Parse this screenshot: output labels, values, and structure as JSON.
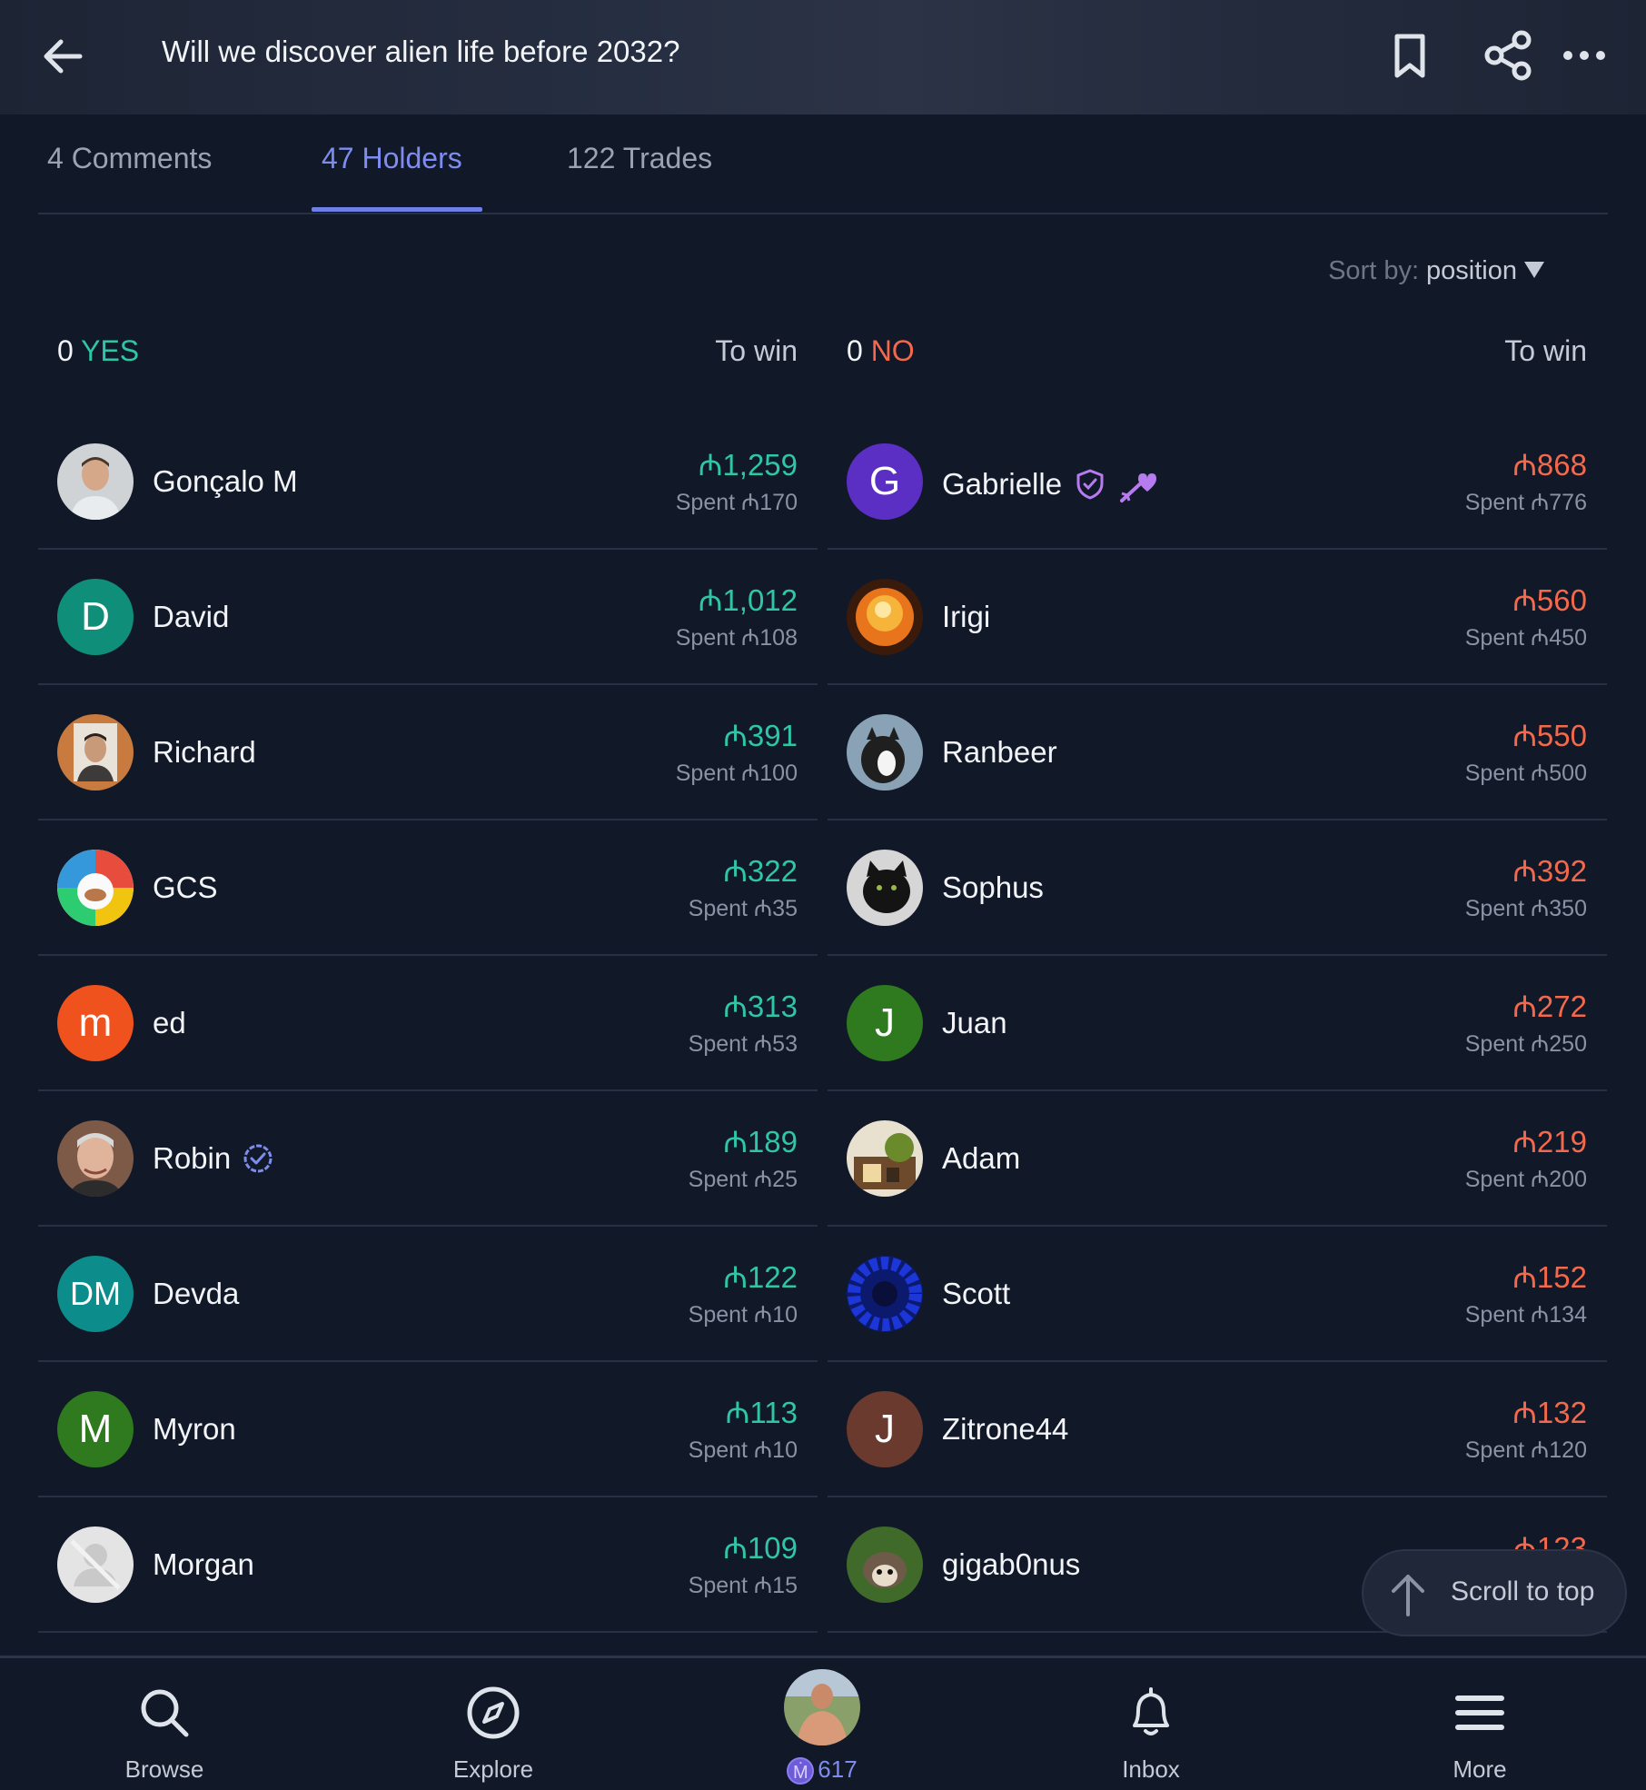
{
  "header": {
    "title": "Will we discover alien life before 2032?",
    "back_icon": "arrow-left-icon",
    "bookmark_icon": "bookmark-icon",
    "share_icon": "share-icon",
    "more_icon": "more-horizontal-icon"
  },
  "tabs": [
    {
      "label": "4 Comments",
      "active": false
    },
    {
      "label": "47 Holders",
      "active": true
    },
    {
      "label": "122 Trades",
      "active": false
    }
  ],
  "sort": {
    "label": "Sort by:",
    "value": "position"
  },
  "yes_column": {
    "count": "0",
    "side": "YES",
    "towin_label": "To win",
    "rows": [
      {
        "name": "Gonçalo M",
        "to_win": "₼1,259",
        "spent": "Spent ₼170"
      },
      {
        "name": "David",
        "to_win": "₼1,012",
        "spent": "Spent ₼108",
        "initials": "D"
      },
      {
        "name": "Richard",
        "to_win": "₼391",
        "spent": "Spent ₼100"
      },
      {
        "name": "GCS",
        "to_win": "₼322",
        "spent": "Spent ₼35"
      },
      {
        "name": "ed",
        "to_win": "₼313",
        "spent": "Spent ₼53",
        "initials": "m"
      },
      {
        "name": "Robin",
        "to_win": "₼189",
        "spent": "Spent ₼25"
      },
      {
        "name": "Devda",
        "to_win": "₼122",
        "spent": "Spent ₼10",
        "initials": "DM"
      },
      {
        "name": "Myron",
        "to_win": "₼113",
        "spent": "Spent ₼10",
        "initials": "M"
      },
      {
        "name": "Morgan",
        "to_win": "₼109",
        "spent": "Spent ₼15"
      }
    ]
  },
  "no_column": {
    "count": "0",
    "side": "NO",
    "towin_label": "To win",
    "rows": [
      {
        "name": "Gabrielle",
        "to_win": "₼868",
        "spent": "Spent ₼776",
        "initials": "G"
      },
      {
        "name": "Irigi",
        "to_win": "₼560",
        "spent": "Spent ₼450"
      },
      {
        "name": "Ranbeer",
        "to_win": "₼550",
        "spent": "Spent ₼500"
      },
      {
        "name": "Sophus",
        "to_win": "₼392",
        "spent": "Spent ₼350"
      },
      {
        "name": "Juan",
        "to_win": "₼272",
        "spent": "Spent ₼250",
        "initials": "J"
      },
      {
        "name": "Adam",
        "to_win": "₼219",
        "spent": "Spent ₼200"
      },
      {
        "name": "Scott",
        "to_win": "₼152",
        "spent": "Spent ₼134"
      },
      {
        "name": "Zitrone44",
        "to_win": "₼132",
        "spent": "Spent ₼120",
        "initials": "J"
      },
      {
        "name": "gigab0nus",
        "to_win": "₼123",
        "spent": ""
      }
    ]
  },
  "scroll_to_top": {
    "label": "Scroll to top"
  },
  "bottom_nav": [
    {
      "label": "Browse",
      "icon": "search-icon"
    },
    {
      "label": "Explore",
      "icon": "compass-icon"
    },
    {
      "label": "617",
      "icon": "profile-avatar",
      "coin": "Ṁ"
    },
    {
      "label": "Inbox",
      "icon": "bell-icon"
    },
    {
      "label": "More",
      "icon": "menu-icon"
    }
  ],
  "colors": {
    "yes": "#2fc6a8",
    "no": "#f4694c",
    "accent": "#7e8cf0",
    "background": "#111828"
  }
}
